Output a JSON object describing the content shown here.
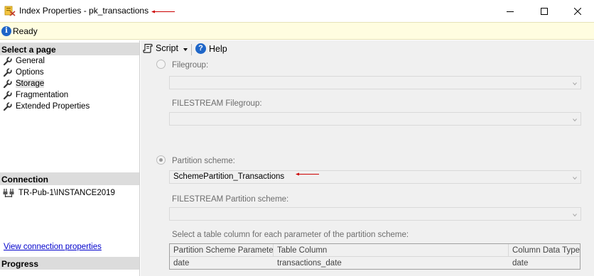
{
  "window": {
    "title": "Index Properties - pk_transactions"
  },
  "status": {
    "text": "Ready"
  },
  "left": {
    "select_page_header": "Select a page",
    "pages": [
      {
        "label": "General"
      },
      {
        "label": "Options"
      },
      {
        "label": "Storage"
      },
      {
        "label": "Fragmentation"
      },
      {
        "label": "Extended Properties"
      }
    ],
    "connection_header": "Connection",
    "connection_server": "TR-Pub-1\\INSTANCE2019",
    "view_connection_link": "View connection properties",
    "progress_header": "Progress"
  },
  "toolbar": {
    "script_label": "Script",
    "help_label": "Help"
  },
  "storage": {
    "filegroup_label": "Filegroup:",
    "filegroup_value": "",
    "filestream_filegroup_label": "FILESTREAM Filegroup:",
    "filestream_filegroup_value": "",
    "partition_scheme_label": "Partition scheme:",
    "partition_scheme_value": "SchemePartition_Transactions",
    "filestream_partition_label": "FILESTREAM Partition scheme:",
    "filestream_partition_value": "",
    "table_column_instruction": "Select a table column for each parameter of the partition scheme:",
    "selected_option": "partition_scheme"
  },
  "partition_grid": {
    "headers": [
      "Partition Scheme Parameter",
      "Table Column",
      "Column Data Type"
    ],
    "rows": [
      [
        "date",
        "transactions_date",
        "date"
      ]
    ]
  },
  "colors": {
    "annotation_arrow": "#cc0000",
    "status_background": "#fffde0",
    "link": "#0000cc"
  },
  "icons": {
    "app": "index-properties-icon",
    "status": "info-icon",
    "page": "wrench-icon",
    "connection": "connection-plug-icon",
    "script": "script-icon",
    "help": "help-icon"
  }
}
